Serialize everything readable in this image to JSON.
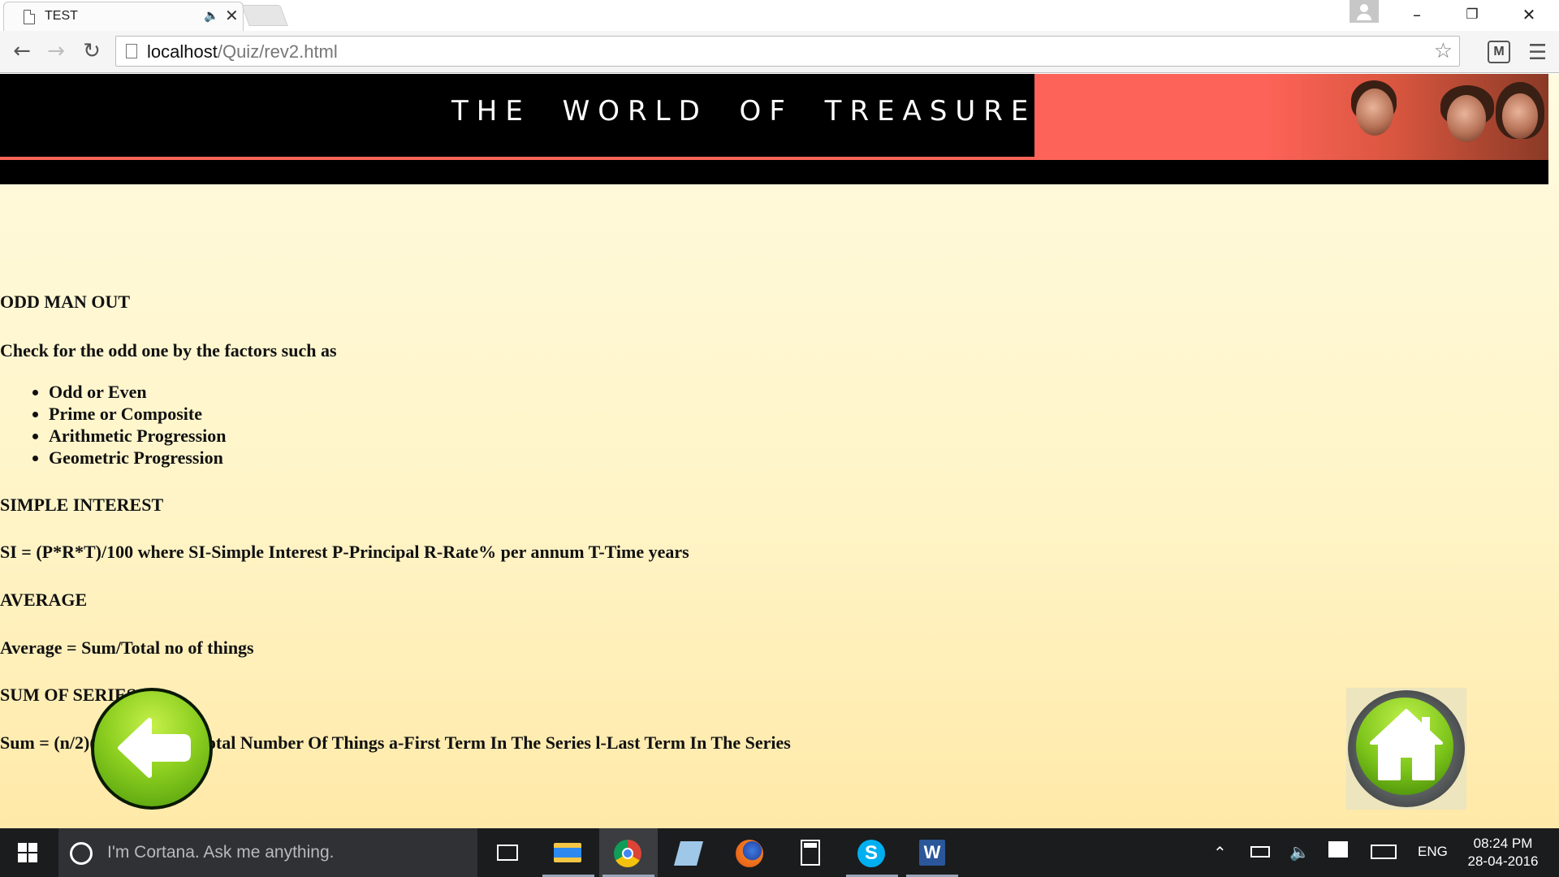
{
  "browser": {
    "tab_title": "TEST",
    "url_host": "localhost",
    "url_path": "/Quiz/rev2.html"
  },
  "page": {
    "banner_title": "THE WORLD OF TREASURE",
    "sections": {
      "odd_man_out_heading": "ODD MAN OUT",
      "odd_man_out_intro": "Check for the odd one by the factors such as",
      "factors": [
        "Odd or Even",
        "Prime or Composite",
        "Arithmetic Progression",
        "Geometric Progression"
      ],
      "simple_interest_heading": "SIMPLE INTEREST",
      "simple_interest_formula": "SI = (P*R*T)/100 where SI-Simple Interest P-Principal R-Rate% per annum T-Time years",
      "average_heading": "AVERAGE",
      "average_formula": "Average = Sum/Total no of things",
      "sum_series_heading": "SUM OF SERIES",
      "sum_series_formula": "Sum = (n/2)(a+l) where n-Total Number Of Things a-First Term In The Series l-Last Term In The Series"
    }
  },
  "taskbar": {
    "cortana_placeholder": "I'm Cortana. Ask me anything.",
    "language": "ENG",
    "time": "08:24 PM",
    "date": "28-04-2016"
  },
  "colors": {
    "banner_accent": "#fd6358",
    "page_background": "#fff4c6",
    "button_green": "#8ed021"
  }
}
